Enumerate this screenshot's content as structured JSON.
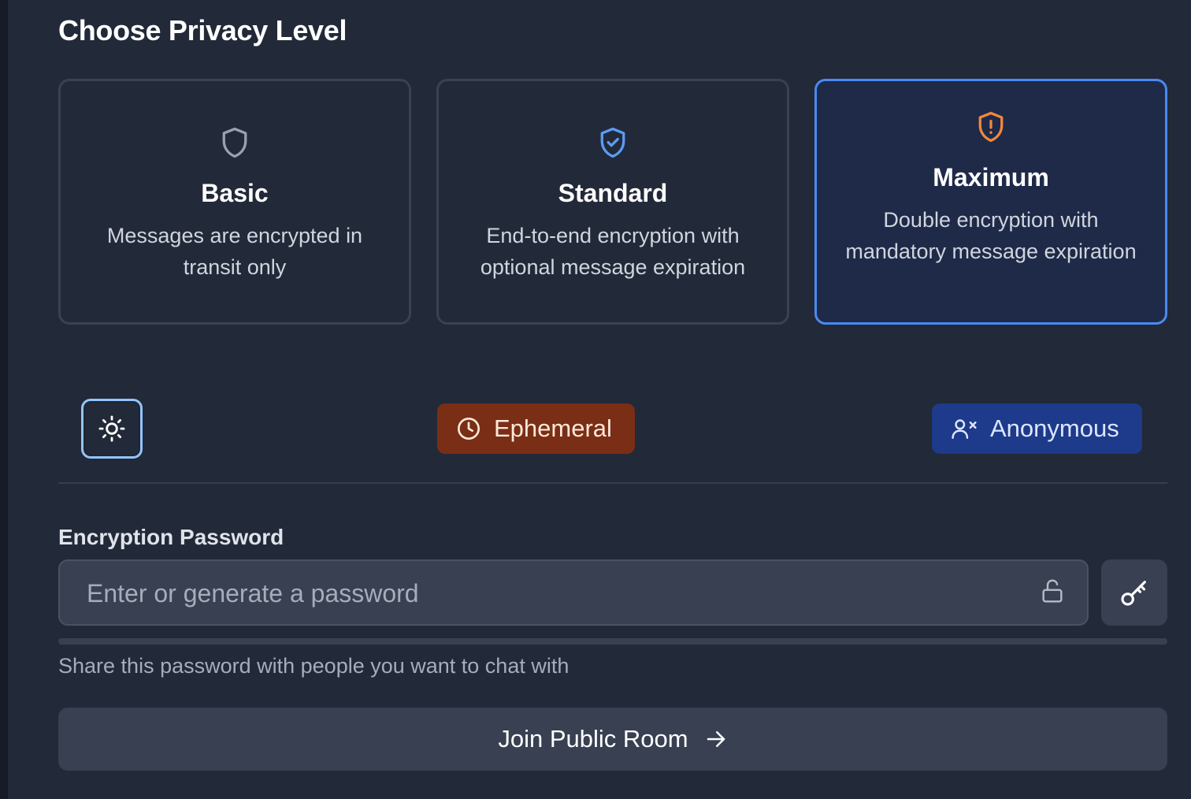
{
  "heading": "Choose Privacy Level",
  "privacy_levels": [
    {
      "title": "Basic",
      "description": "Messages are encrypted in transit only",
      "icon": "shield-icon",
      "selected": false
    },
    {
      "title": "Standard",
      "description": "End-to-end encryption with optional message expiration",
      "icon": "shield-check-icon",
      "selected": false
    },
    {
      "title": "Maximum",
      "description": "Double encryption with mandatory message expiration",
      "icon": "shield-alert-icon",
      "selected": true
    }
  ],
  "toggles": {
    "theme_icon": "sun-icon",
    "ephemeral_label": "Ephemeral",
    "anonymous_label": "Anonymous"
  },
  "password": {
    "label": "Encryption Password",
    "placeholder": "Enter or generate a password",
    "value": "",
    "hint": "Share this password with people you want to chat with"
  },
  "join_button": {
    "label": "Join Public Room"
  },
  "colors": {
    "background": "#222938",
    "selected_border": "#4a8af2",
    "ephemeral_bg": "#7a2e16",
    "anonymous_bg": "#1e3a8a",
    "warning_icon": "#f0883e",
    "accent_icon": "#5b9cf5"
  }
}
